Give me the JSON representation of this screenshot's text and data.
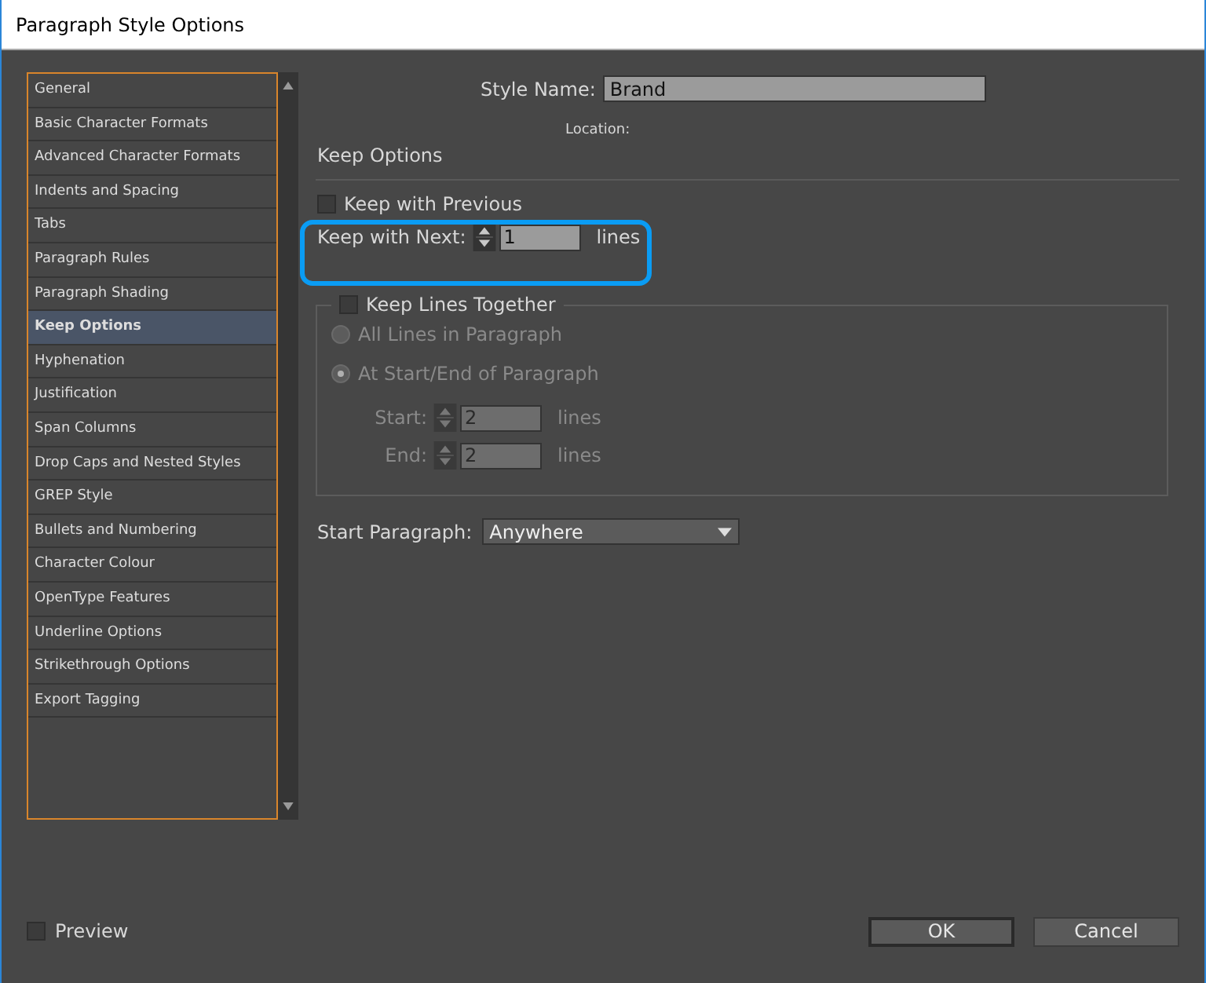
{
  "window": {
    "title": "Paragraph Style Options"
  },
  "sidebar": {
    "items": [
      {
        "label": "General",
        "selected": false
      },
      {
        "label": "Basic Character Formats",
        "selected": false
      },
      {
        "label": "Advanced Character Formats",
        "selected": false
      },
      {
        "label": "Indents and Spacing",
        "selected": false
      },
      {
        "label": "Tabs",
        "selected": false
      },
      {
        "label": "Paragraph Rules",
        "selected": false
      },
      {
        "label": "Paragraph Shading",
        "selected": false
      },
      {
        "label": "Keep Options",
        "selected": true
      },
      {
        "label": "Hyphenation",
        "selected": false
      },
      {
        "label": "Justification",
        "selected": false
      },
      {
        "label": "Span Columns",
        "selected": false
      },
      {
        "label": "Drop Caps and Nested Styles",
        "selected": false
      },
      {
        "label": "GREP Style",
        "selected": false
      },
      {
        "label": "Bullets and Numbering",
        "selected": false
      },
      {
        "label": "Character Colour",
        "selected": false
      },
      {
        "label": "OpenType Features",
        "selected": false
      },
      {
        "label": "Underline Options",
        "selected": false
      },
      {
        "label": "Strikethrough Options",
        "selected": false
      },
      {
        "label": "Export Tagging",
        "selected": false
      }
    ]
  },
  "style_name": {
    "label": "Style Name:",
    "value": "Brand"
  },
  "location_label": "Location:",
  "section_title": "Keep Options",
  "keep_with_previous": {
    "label": "Keep with Previous",
    "checked": false
  },
  "keep_with_next": {
    "label": "Keep with Next:",
    "value": "1",
    "unit": "lines"
  },
  "keep_lines_together": {
    "label": "Keep Lines Together",
    "checked": false,
    "options": [
      {
        "label": "All Lines in Paragraph",
        "selected": false
      },
      {
        "label": "At Start/End of Paragraph",
        "selected": true
      }
    ],
    "fields": [
      {
        "label": "Start:",
        "value": "2",
        "unit": "lines"
      },
      {
        "label": "End:",
        "value": "2",
        "unit": "lines"
      }
    ]
  },
  "start_paragraph": {
    "label": "Start Paragraph:",
    "value": "Anywhere"
  },
  "preview": {
    "label": "Preview",
    "checked": false
  },
  "buttons": [
    {
      "label": "OK",
      "default": true
    },
    {
      "label": "Cancel",
      "default": false
    }
  ]
}
